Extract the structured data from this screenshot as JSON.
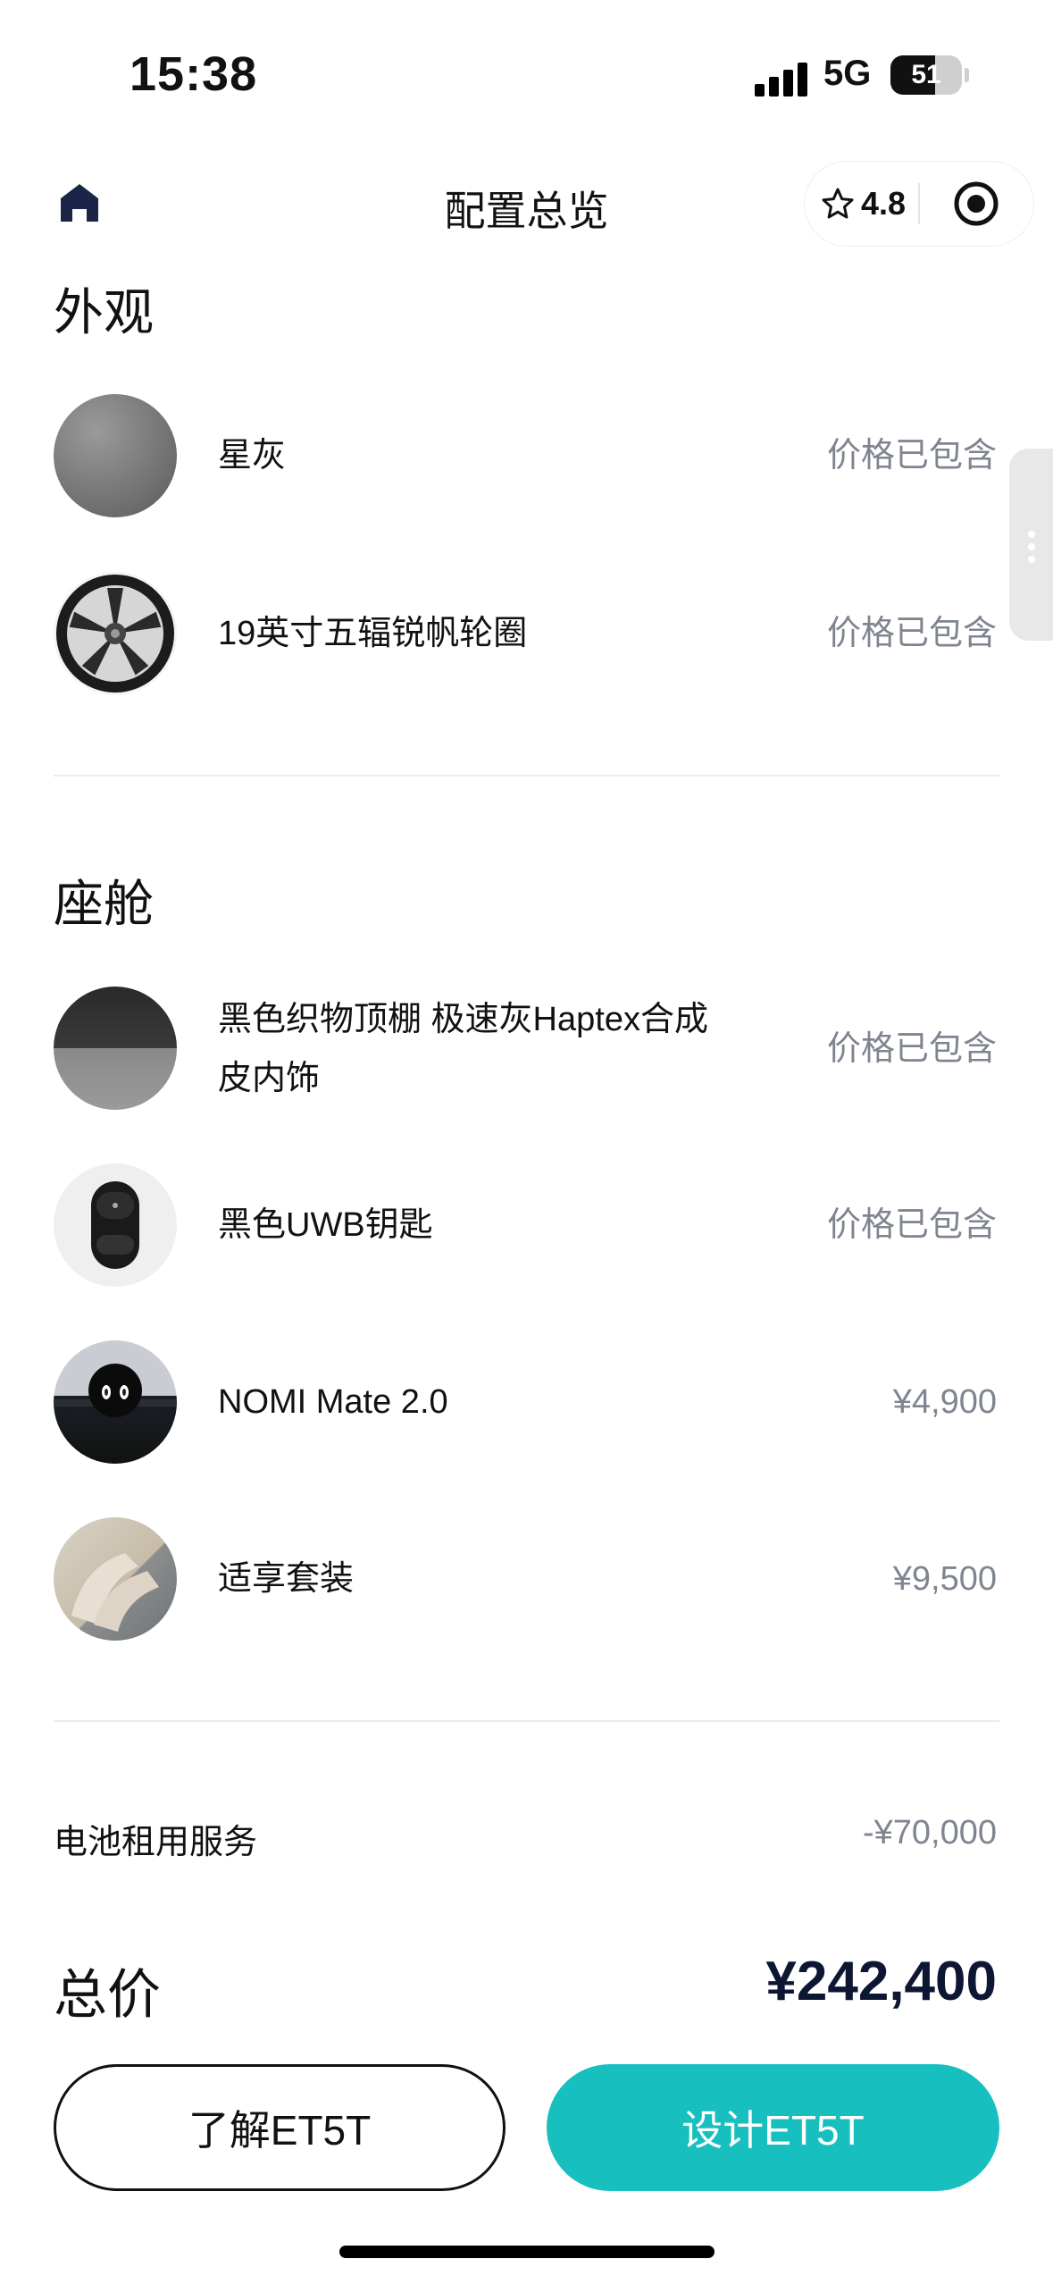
{
  "status_bar": {
    "time": "15:38",
    "network": "5G",
    "battery_level": "51"
  },
  "nav": {
    "title": "配置总览",
    "rating": "4.8"
  },
  "sections": {
    "exterior": {
      "title": "外观",
      "items": [
        {
          "name": "星灰",
          "price": "价格已包含"
        },
        {
          "name": "19英寸五辐锐帆轮圈",
          "price": "价格已包含"
        }
      ]
    },
    "cabin": {
      "title": "座舱",
      "items": [
        {
          "name": "黑色织物顶棚 极速灰Haptex合成皮内饰",
          "price": "价格已包含"
        },
        {
          "name": "黑色UWB钥匙",
          "price": "价格已包含"
        },
        {
          "name": "NOMI Mate 2.0",
          "price": "¥4,900"
        },
        {
          "name": "适享套装",
          "price": "¥9,500"
        }
      ]
    }
  },
  "battery_service": {
    "label": "电池租用服务",
    "value": "-¥70,000"
  },
  "total": {
    "label": "总价",
    "value": "¥242,400"
  },
  "buttons": {
    "learn": "了解ET5T",
    "design": "设计ET5T"
  },
  "colors": {
    "accent": "#17bfbf",
    "total_text": "#0d1733",
    "muted_text": "#7f8590",
    "nav_icon": "#1a2548"
  },
  "icons": [
    "home-icon",
    "star-icon",
    "target-icon",
    "more-dots-icon"
  ]
}
